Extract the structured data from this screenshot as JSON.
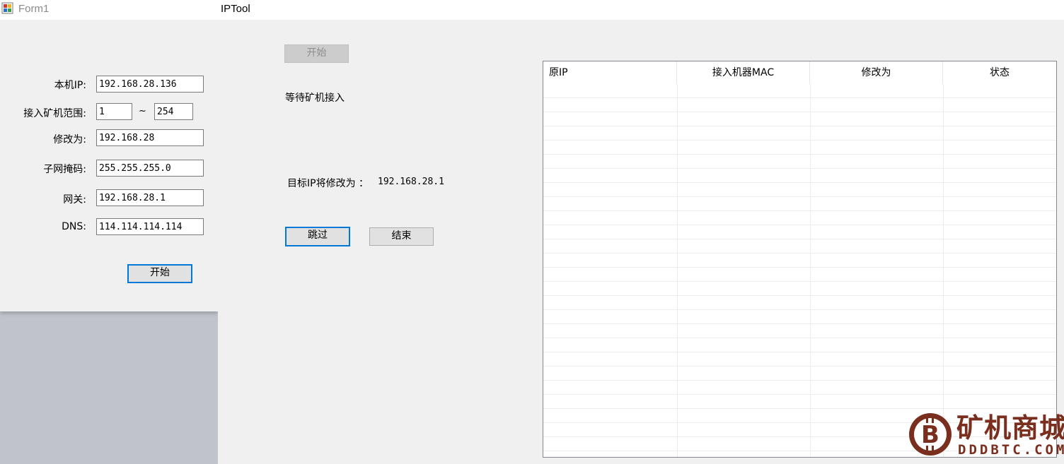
{
  "form1": {
    "title": "Form1",
    "labels": {
      "local_ip": "本机IP:",
      "range": "接入矿机范围:",
      "modify_to": "修改为:",
      "subnet": "子网掩码:",
      "gateway": "网关:",
      "dns": "DNS:"
    },
    "fields": {
      "local_ip": "192.168.28.136",
      "range_start": "1",
      "range_sep": "~",
      "range_end": "254",
      "modify_to": "192.168.28",
      "subnet": "255.255.255.0",
      "gateway": "192.168.28.1",
      "dns": "114.114.114.114"
    },
    "start_button": "开始"
  },
  "iptool": {
    "title": "IPTool",
    "start_button": "开始",
    "status_text": "等待矿机接入",
    "target_label": "目标IP将修改为 ：",
    "target_ip": "192.168.28.1",
    "skip_button": "跳过",
    "end_button": "结束",
    "table": {
      "columns": [
        "原IP",
        "接入机器MAC",
        "修改为",
        "状态"
      ]
    }
  },
  "watermark": {
    "name": "矿机商城",
    "url": "DDDBTC.COM"
  },
  "colors": {
    "focus_blue": "#0078d7",
    "watermark_brown": "#7a2e1e"
  }
}
